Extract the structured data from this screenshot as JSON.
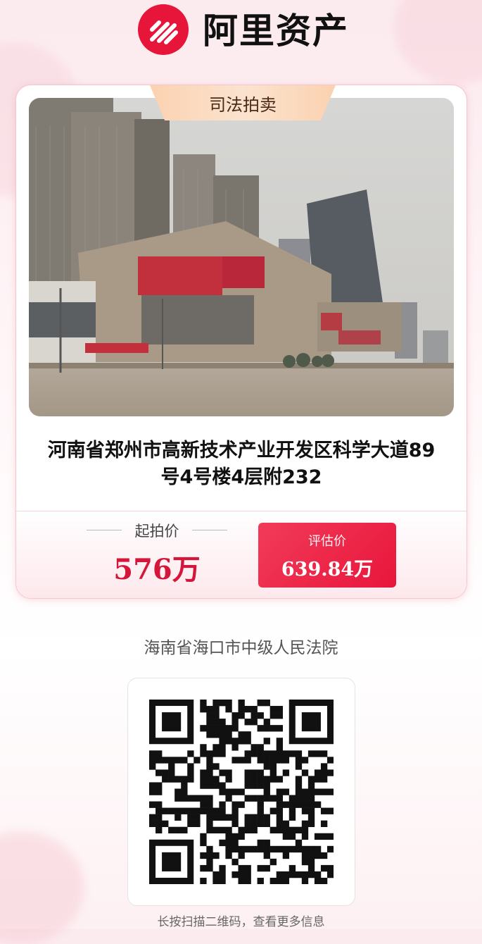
{
  "header": {
    "brand_name": "阿里资产",
    "brand_color": "#e8153a"
  },
  "listing": {
    "tag": "司法拍卖",
    "photo": "building-photo",
    "address": "河南省郑州市高新技术产业开发区科学大道89号4号楼4层附232"
  },
  "price": {
    "start_label": "起拍价",
    "start_value": "576万",
    "eval_label": "评估价",
    "eval_value": "639.84万",
    "accent_color": "#d4163a"
  },
  "court": "海南省海口市中级人民法院",
  "qr": {
    "icon": "qr-code-icon",
    "hint": "长按扫描二维码，查看更多信息"
  }
}
